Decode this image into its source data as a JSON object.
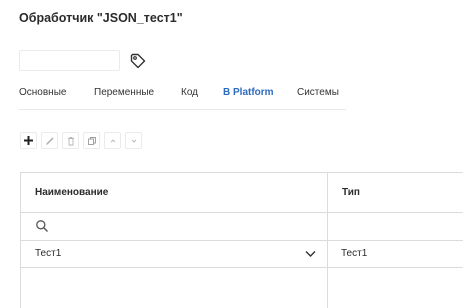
{
  "header": {
    "title": "Обработчик \"JSON_тест1\""
  },
  "name_field": {
    "value": "",
    "placeholder": ""
  },
  "tabs": [
    {
      "label": "Основные",
      "active": false
    },
    {
      "label": "Переменные",
      "active": false
    },
    {
      "label": "Код",
      "active": false
    },
    {
      "label": "B Platform",
      "active": true
    },
    {
      "label": "Системы",
      "active": false
    }
  ],
  "toolbar": {
    "buttons": [
      "plus-icon",
      "pencil-icon",
      "trash-icon",
      "copy-icon",
      "arrow-up-icon",
      "arrow-down-icon"
    ]
  },
  "table": {
    "columns": [
      "Наименование",
      "Тип"
    ],
    "rows": [
      {
        "name": "Тест1",
        "type": "Тест1"
      }
    ]
  },
  "colors": {
    "active_tab": "#2d6bbf",
    "border": "#dcdcdc"
  }
}
